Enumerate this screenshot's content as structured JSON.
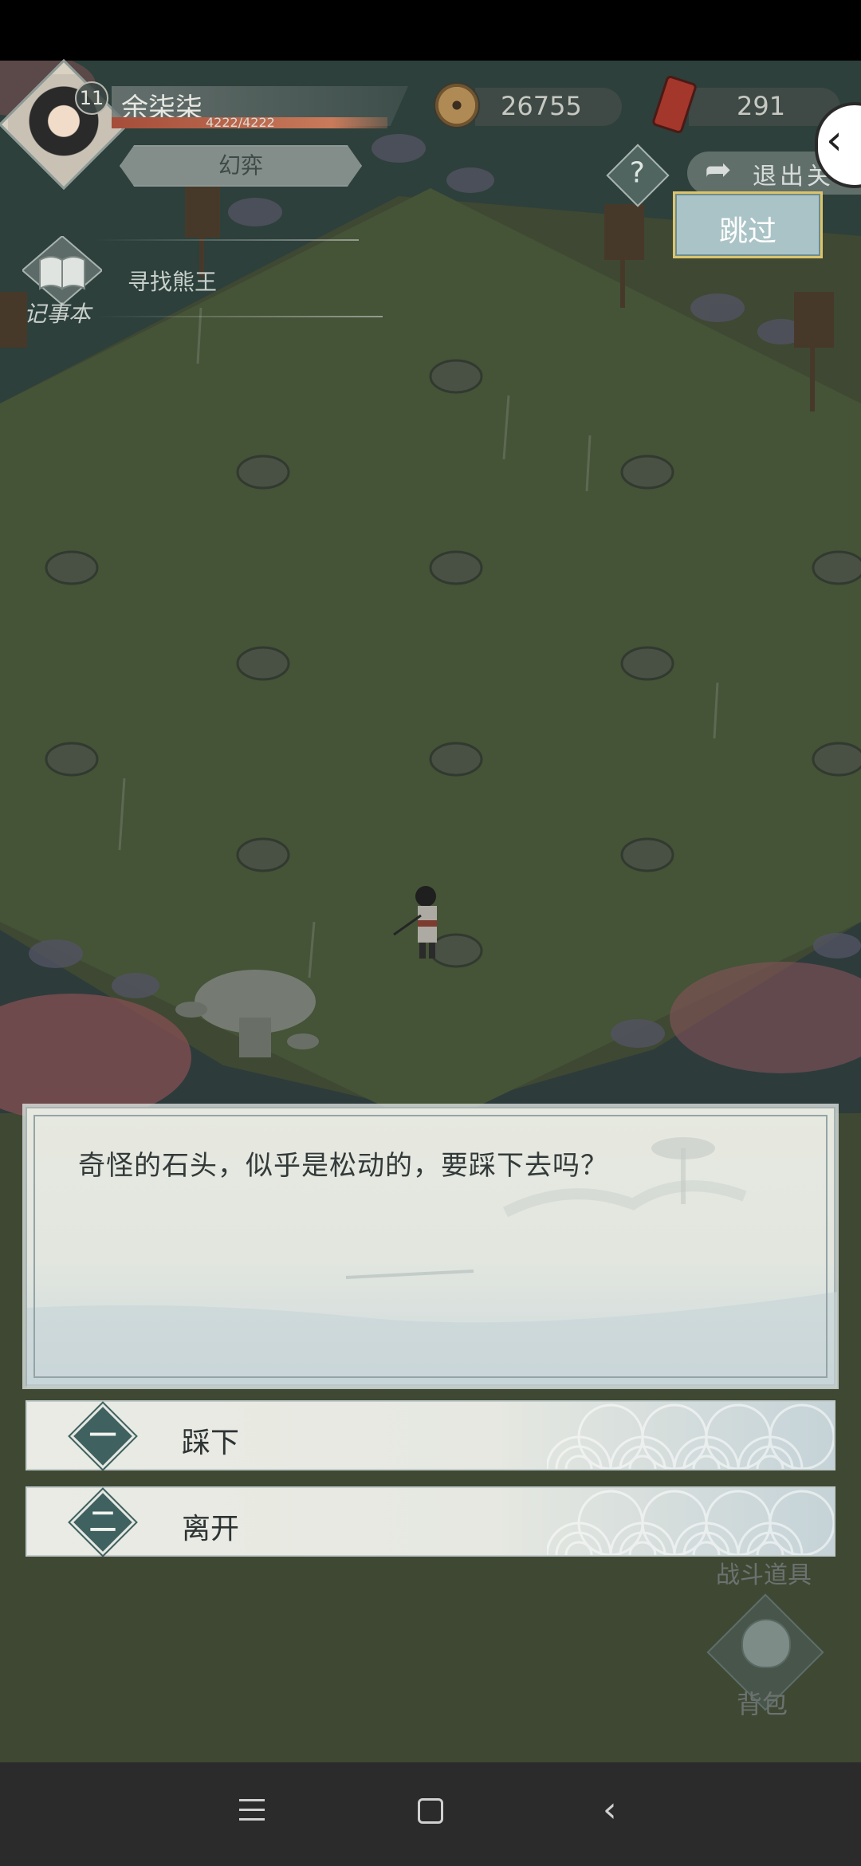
{
  "hud": {
    "player_name": "余柒柒",
    "level": "11",
    "hp_text": "4222/4222",
    "realm": "幻弈",
    "coins": "26755",
    "tokens": "291",
    "exit_label": "退出关",
    "help_symbol": "?",
    "skip_label": "跳过"
  },
  "journal": {
    "label": "记事本",
    "current_quest": "寻找熊王"
  },
  "dialog": {
    "text": "奇怪的石头，似乎是松动的，要踩下去吗？",
    "options": [
      {
        "number": "一",
        "label": "踩下"
      },
      {
        "number": "二",
        "label": "离开"
      }
    ]
  },
  "side_menu": {
    "battle_items": "战斗道具",
    "bag": "背包"
  },
  "colors": {
    "grass": "#4f5a3f",
    "option_diamond": "#3f6160",
    "skip_button": "#aac3c6",
    "hp_bar": "#a54d3a"
  },
  "icons": [
    "coin-icon",
    "token-icon",
    "back-chevron-icon",
    "help-icon",
    "exit-arrow-icon",
    "journal-book-icon",
    "bag-icon",
    "nav-menu-icon",
    "nav-home-icon",
    "nav-back-icon"
  ]
}
